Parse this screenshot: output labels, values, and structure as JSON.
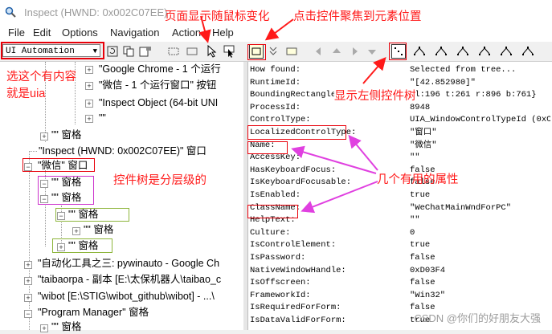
{
  "window": {
    "title": "Inspect  (HWND: 0x002C07EE)"
  },
  "menu": [
    "File",
    "Edit",
    "Options",
    "Navigation",
    "Action",
    "Help"
  ],
  "mode_select": {
    "value": "UI Automation"
  },
  "tree": [
    {
      "label": "\"Google Chrome - 1 个运行",
      "level": 4,
      "expander": "+"
    },
    {
      "label": "\"微信 - 1 个运行窗口\" 按钮",
      "level": 4,
      "expander": "+"
    },
    {
      "label": "\"Inspect Object (64-bit UNI",
      "level": 4,
      "expander": "+"
    },
    {
      "label": "\"\"",
      "level": 4,
      "expander": "+"
    },
    {
      "label": "\"\" 窗格",
      "level": 2,
      "expander": "+"
    },
    {
      "label": "\"Inspect  (HWND: 0x002C07EE)\" 窗口",
      "level": 2,
      "expander": ""
    },
    {
      "label": "\"微信\" 窗口",
      "level": 1,
      "expander": "-"
    },
    {
      "label": "\"\" 窗格",
      "level": 2,
      "expander": "-"
    },
    {
      "label": "\"\" 窗格",
      "level": 2,
      "expander": "-"
    },
    {
      "label": "\"\" 窗格",
      "level": 3,
      "expander": "-"
    },
    {
      "label": "\"\" 窗格",
      "level": 4,
      "expander": "+"
    },
    {
      "label": "\"\" 窗格",
      "level": 3,
      "expander": "+"
    },
    {
      "label": "\"自动化工具之三: pywinauto - Google Ch",
      "level": 1,
      "expander": "+"
    },
    {
      "label": "\"taibaorpa - 副本 [E:\\太保机器人\\taibao_c",
      "level": 1,
      "expander": "+"
    },
    {
      "label": "\"wibot [E:\\STIG\\wibot_github\\wibot] - ...\\",
      "level": 1,
      "expander": "+"
    },
    {
      "label": "\"Program Manager\" 窗格",
      "level": 1,
      "expander": "-"
    },
    {
      "label": "\"\" 窗格",
      "level": 2,
      "expander": "+"
    }
  ],
  "properties": [
    {
      "name": "How found:",
      "value": "Selected from tree..."
    },
    {
      "name": "RuntimeId:",
      "value": "\"[42.852980]\""
    },
    {
      "name": "BoundingRectangle:",
      "value": "{l:196 t:261 r:896 b:761}"
    },
    {
      "name": "ProcessId:",
      "value": "8948"
    },
    {
      "name": "ControlType:",
      "value": "UIA_WindowControlTypeId (0xC37"
    },
    {
      "name": "LocalizedControlType:",
      "value": "\"窗口\""
    },
    {
      "name": "Name:",
      "value": "\"微信\""
    },
    {
      "name": "AccessKey:",
      "value": "\"\""
    },
    {
      "name": "HasKeyboardFocus:",
      "value": "false"
    },
    {
      "name": "IsKeyboardFocusable:",
      "value": "false"
    },
    {
      "name": "IsEnabled:",
      "value": "true"
    },
    {
      "name": "ClassName:",
      "value": "\"WeChatMainWndForPC\""
    },
    {
      "name": "HelpText:",
      "value": "\"\""
    },
    {
      "name": "Culture:",
      "value": "0"
    },
    {
      "name": "IsControlElement:",
      "value": "true"
    },
    {
      "name": "IsPassword:",
      "value": "false"
    },
    {
      "name": "NativeWindowHandle:",
      "value": "0xD03F4"
    },
    {
      "name": "IsOffscreen:",
      "value": "false"
    },
    {
      "name": "FrameworkId:",
      "value": "\"Win32\""
    },
    {
      "name": "IsRequiredForForm:",
      "value": "false"
    },
    {
      "name": "IsDataValidForForm:",
      "value": "true"
    }
  ],
  "annotations": {
    "mouse_follow": "页面显示随鼠标变化",
    "click_focus": "点击控件聚焦到元素位置",
    "choose_uia_1": "选这个有内容",
    "choose_uia_2": "就是uia",
    "show_left_control": "显示左侧控件树",
    "tree_hierarchy": "控件树是分层级的",
    "common_props": "几个有用的属性"
  },
  "watermark": "CSDN @你们的好朋友大强",
  "colors": {
    "annotation": "#ff1a1a",
    "box_red": "#e8000a",
    "box_magenta": "#cc33cc",
    "box_green": "#8db53b",
    "arrow_magenta": "#e040e0"
  }
}
